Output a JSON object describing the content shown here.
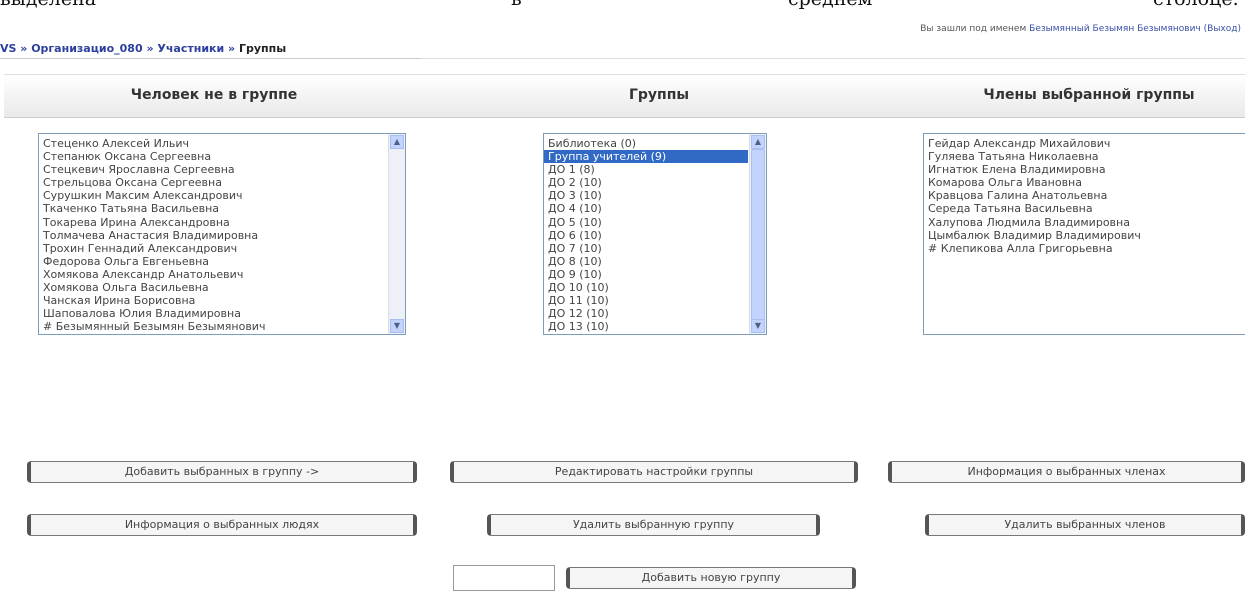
{
  "doc_text": {
    "left": "выделена",
    "middle1": "в",
    "middle2": "среднем",
    "right": "столбце."
  },
  "login": {
    "prefix": "Вы зашли под именем",
    "user": "Безымянный Безымян Безымянович",
    "logout": "(Выход)"
  },
  "breadcrumb": {
    "root": "VS",
    "sep1": " » ",
    "org": "Организацио_080",
    "sep2": " » ",
    "participants": "Участники",
    "sep3": " » ",
    "current": "Группы"
  },
  "columns": {
    "not_in_group": "Человек не в группе",
    "groups": "Группы",
    "members": "Члены выбранной группы"
  },
  "not_in_group_list": [
    "Стеценко Алексей Ильич",
    "Степанюк Оксана Сергеевна",
    "Стецкевич Ярославна Сергеевна",
    "Стрельцова Оксана Сергеевна",
    "Сурушкин Максим Александрович",
    "Ткаченко Татьяна Васильевна",
    "Токарева Ирина Александровна",
    "Толмачева Анастасия Владимировна",
    "Трохин Геннадий Александрович",
    "Федорова Ольга Евгеньевна",
    "Хомякова Александр Анатольевич",
    "Хомякова Ольга Васильевна",
    "Чанская Ирина Борисовна",
    "Шаповалова Юлия Владимировна",
    "# Безымянный Безымян Безымянович"
  ],
  "groups_list": [
    "Библиотека (0)",
    "Группа учителей (9)",
    "ДО 1 (8)",
    "ДО 2 (10)",
    "ДО 3 (10)",
    "ДО 4 (10)",
    "ДО 5 (10)",
    "ДО 6 (10)",
    "ДО 7 (10)",
    "ДО 8 (10)",
    "ДО 9 (10)",
    "ДО 10 (10)",
    "ДО 11 (10)",
    "ДО 12 (10)",
    "ДО 13 (10)"
  ],
  "groups_selected_index": 1,
  "members_list": [
    "Гейдар Александр Михайлович",
    "Гуляева Татьяна Николаевна",
    "Игнатюк Елена Владимировна",
    "Комарова Ольга Ивановна",
    "Кравцова Галина Анатольевна",
    "Середа Татьяна Васильевна",
    "Халупова Людмила Владимировна",
    "Цымбалюк Владимир Владимирович",
    "# Клепикова Алла Григорьевна"
  ],
  "buttons": {
    "add_selected": "Добавить выбранных в группу ->",
    "person_info": "Информация о выбранных людях",
    "edit_group": "Редактировать настройки группы",
    "delete_group": "Удалить выбранную группу",
    "member_info": "Информация о выбранных членах",
    "delete_members": "Удалить выбранных членов",
    "add_group": "Добавить новую группу"
  },
  "new_group_value": "",
  "colors": {
    "selection": "#316ac5",
    "link": "#2c3f9e",
    "listbox_border": "#7f9db9",
    "scroll_button": "#c3d3fd"
  }
}
